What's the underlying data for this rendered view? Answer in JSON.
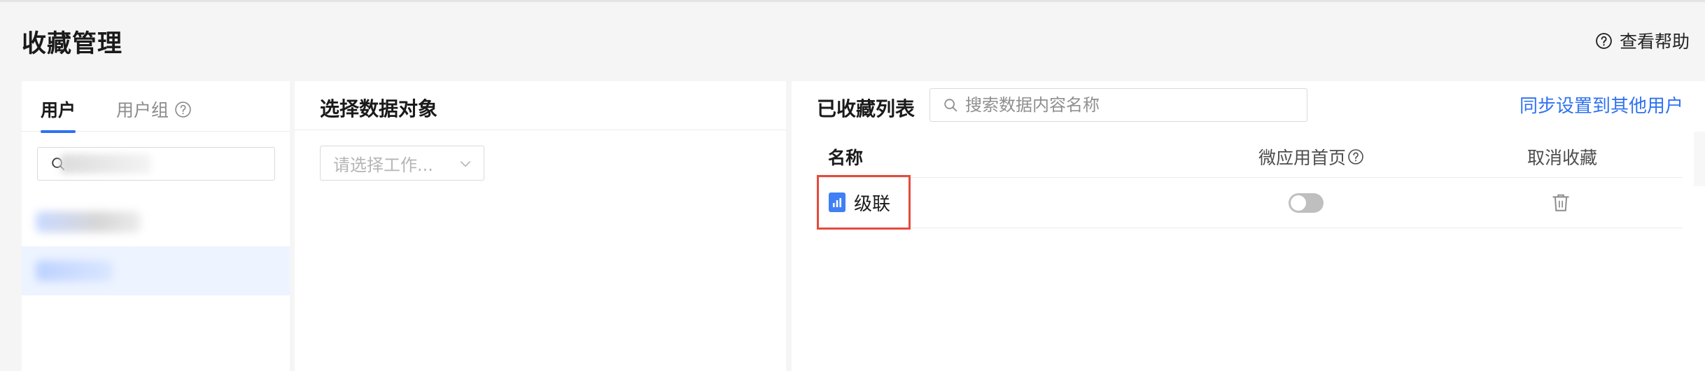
{
  "page": {
    "title": "收藏管理",
    "help_label": "查看帮助"
  },
  "users_panel": {
    "tabs": [
      {
        "label": "用户",
        "active": true
      },
      {
        "label": "用户组",
        "active": false
      }
    ],
    "search_value": "",
    "items": [
      {
        "label": "",
        "selected": false
      },
      {
        "label": "",
        "selected": true
      }
    ]
  },
  "select_panel": {
    "title": "选择数据对象",
    "workspace_placeholder": "请选择工作..."
  },
  "list_panel": {
    "title": "已收藏列表",
    "search_placeholder": "搜索数据内容名称",
    "sync_link": "同步设置到其他用户",
    "columns": [
      "名称",
      "微应用首页",
      "取消收藏"
    ],
    "rows": [
      {
        "name": "级联",
        "icon": "chart-icon",
        "micro_app_home": false
      }
    ]
  },
  "colors": {
    "accent": "#2f72f0",
    "highlight_border": "#e64a3c",
    "selected_row_bg": "#edf4ff",
    "toggle_off": "#bfbfbf"
  }
}
